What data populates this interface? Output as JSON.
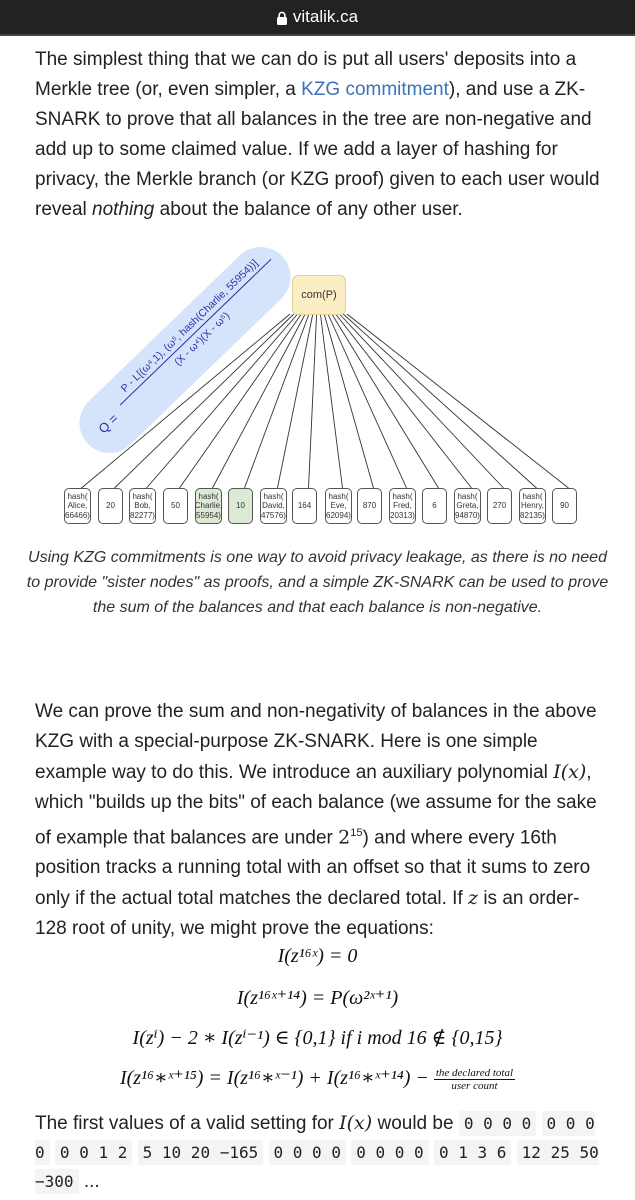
{
  "browser": {
    "url": "vitalik.ca",
    "lock_icon": "lock-icon"
  },
  "intro": {
    "before_link": "The simplest thing that we can do is put all users' deposits into a Merkle tree (or, even simpler, a ",
    "link": "KZG commitment",
    "after_link": "), and use a ZK-SNARK to prove that all balances in the tree are non-negative and add up to some claimed value. If we add a layer of hashing for privacy, the Merkle branch (or KZG proof) given to each user would reveal ",
    "emphasis": "nothing",
    "end": " about the balance of any other user."
  },
  "diagram": {
    "root_label": "com(P)",
    "quotient": {
      "lhs": "Q =",
      "numerator": "P - L[(ω⁴,1), (ω⁵, hash(Charlie, 55954))]",
      "denominator": "(X - ω⁴)(X - ω⁵)"
    },
    "leaves": [
      {
        "text": "hash( Alice, 66466)",
        "highlight": false
      },
      {
        "text": "20",
        "highlight": false
      },
      {
        "text": "hash( Bob, 82277)",
        "highlight": false
      },
      {
        "text": "50",
        "highlight": false
      },
      {
        "text": "hash( Charlie, 55954)",
        "highlight": true
      },
      {
        "text": "10",
        "highlight": true
      },
      {
        "text": "hash( David, 47576)",
        "highlight": false
      },
      {
        "text": "164",
        "highlight": false
      },
      {
        "text": "hash( Eve, 62094)",
        "highlight": false
      },
      {
        "text": "870",
        "highlight": false
      },
      {
        "text": "hash( Fred, 20313)",
        "highlight": false
      },
      {
        "text": "6",
        "highlight": false
      },
      {
        "text": "hash( Greta, 94870)",
        "highlight": false
      },
      {
        "text": "270",
        "highlight": false
      },
      {
        "text": "hash( Henry, 82135)",
        "highlight": false
      },
      {
        "text": "90",
        "highlight": false
      }
    ]
  },
  "caption": "Using KZG commitments is one way to avoid privacy leakage, as there is no need to provide \"sister nodes\" as proofs, and a simple ZK-SNARK can be used to prove the sum of the balances and that each balance is non-negative.",
  "body": {
    "p1": "We can prove the sum and non-negativity of balances in the above KZG with a special-purpose ZK-SNARK. Here is one simple example way to do this. We introduce an auxiliary polynomial ",
    "p1_math": "I(x)",
    "p2": ", which \"builds up the bits\" of each balance (we assume for the sake of example that balances are under ",
    "p2_math": "2",
    "p2_sup": "15",
    "p3": ") and where every 16th position tracks a running total with an offset so that it sums to zero only if the actual total matches the declared total. If ",
    "p3_math": "z",
    "p4": " is an order-128 root of unity, we might prove the equations:"
  },
  "equations": {
    "e1": "I(z¹⁶ˣ) = 0",
    "e2": "I(z¹⁶ˣ⁺¹⁴) = P(ω²ˣ⁺¹)",
    "e3": "I(zⁱ) − 2 ∗ I(zⁱ⁻¹) ∈ {0,1}  if  i  mod 16 ∉ {0,15}",
    "e4_main": "I(z¹⁶∗ˣ⁺¹⁵) = I(z¹⁶∗ˣ⁻¹) + I(z¹⁶∗ˣ⁺¹⁴) − ",
    "e4_num": "the declared total",
    "e4_den": "user count"
  },
  "values": {
    "intro": "The first values of a valid setting for ",
    "math": "I(x)",
    "mid": " would be ",
    "groups": [
      "0 0 0 0",
      "0 0 0 0",
      "0 0 1 2",
      "5 10 20 −165",
      "0 0 0 0",
      "0 0 0 0",
      "0 1 3 6",
      "12 25 50 −300"
    ],
    "ellipsis": "..."
  }
}
